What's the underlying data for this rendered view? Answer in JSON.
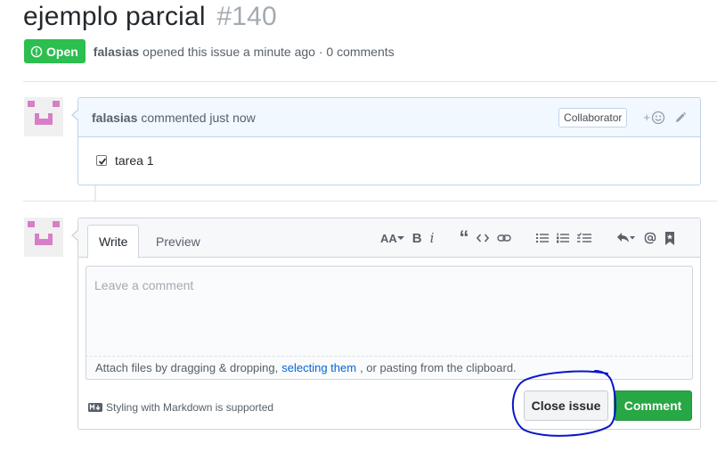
{
  "issue": {
    "title": "ejemplo parcial",
    "number": "#140",
    "state": "Open",
    "author": "falasias",
    "opened_text": "opened this issue a minute ago · 0 comments"
  },
  "comment": {
    "author": "falasias",
    "action_text": "commented just now",
    "role_badge": "Collaborator",
    "reaction_plus": "+",
    "task_label": "tarea 1",
    "task_checked": true
  },
  "editor": {
    "tabs": [
      {
        "label": "Write",
        "selected": true
      },
      {
        "label": "Preview",
        "selected": false
      }
    ],
    "toolbar": {
      "heading": "AA",
      "bold": "B",
      "italic": "i",
      "quote": "“"
    },
    "placeholder": "Leave a comment",
    "attach_prefix": "Attach files by dragging & dropping,",
    "attach_link": "selecting them",
    "attach_suffix": ", or pasting from the clipboard.",
    "markdown_note": "Styling with Markdown is supported",
    "close_button": "Close issue",
    "comment_button": "Comment"
  },
  "colors": {
    "open_green": "#2cbe4e",
    "comment_green": "#28a745",
    "link_blue": "#0366d6",
    "annotation_blue": "#0a16c8",
    "avatar_pink": "#d67fc7"
  },
  "icons": [
    "issue-opened-icon",
    "smiley-icon",
    "pencil-icon",
    "checkbox-icon",
    "heading-icon",
    "bold-icon",
    "italic-icon",
    "quote-icon",
    "code-icon",
    "link-icon",
    "unordered-list-icon",
    "ordered-list-icon",
    "tasklist-icon",
    "reply-icon",
    "mention-icon",
    "bookmark-icon",
    "markdown-icon",
    "resize-grip-icon"
  ]
}
